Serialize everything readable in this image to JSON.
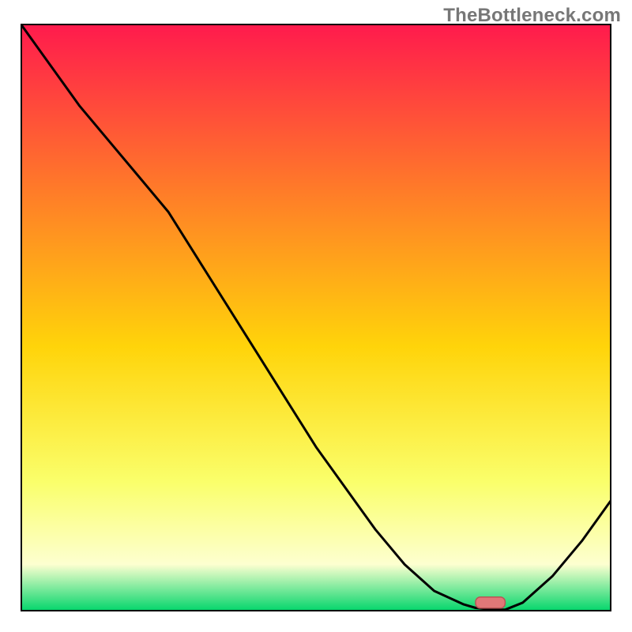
{
  "watermark": "TheBottleneck.com",
  "colors": {
    "gradient_top": "#ff1a4d",
    "gradient_mid_upper": "#ff7a29",
    "gradient_mid": "#ffd40a",
    "gradient_lower": "#faff6b",
    "gradient_pale": "#fdffd0",
    "gradient_bottom": "#00d56a",
    "curve": "#000000",
    "marker_fill": "#e07878",
    "marker_stroke": "#b85555"
  },
  "chart_data": {
    "type": "line",
    "title": "",
    "xlabel": "",
    "ylabel": "",
    "x": [
      0.0,
      0.05,
      0.1,
      0.15,
      0.2,
      0.25,
      0.3,
      0.35,
      0.4,
      0.45,
      0.5,
      0.55,
      0.6,
      0.65,
      0.7,
      0.75,
      0.77,
      0.8,
      0.82,
      0.85,
      0.9,
      0.95,
      1.0
    ],
    "values": [
      1.0,
      0.93,
      0.86,
      0.8,
      0.74,
      0.68,
      0.6,
      0.52,
      0.44,
      0.36,
      0.28,
      0.21,
      0.14,
      0.08,
      0.035,
      0.012,
      0.006,
      0.003,
      0.003,
      0.015,
      0.06,
      0.12,
      0.19
    ],
    "xlim": [
      0,
      1
    ],
    "ylim": [
      0,
      1
    ],
    "marker": {
      "x_start": 0.77,
      "x_end": 0.82,
      "y": 0.015
    },
    "grid": false,
    "legend": false
  }
}
